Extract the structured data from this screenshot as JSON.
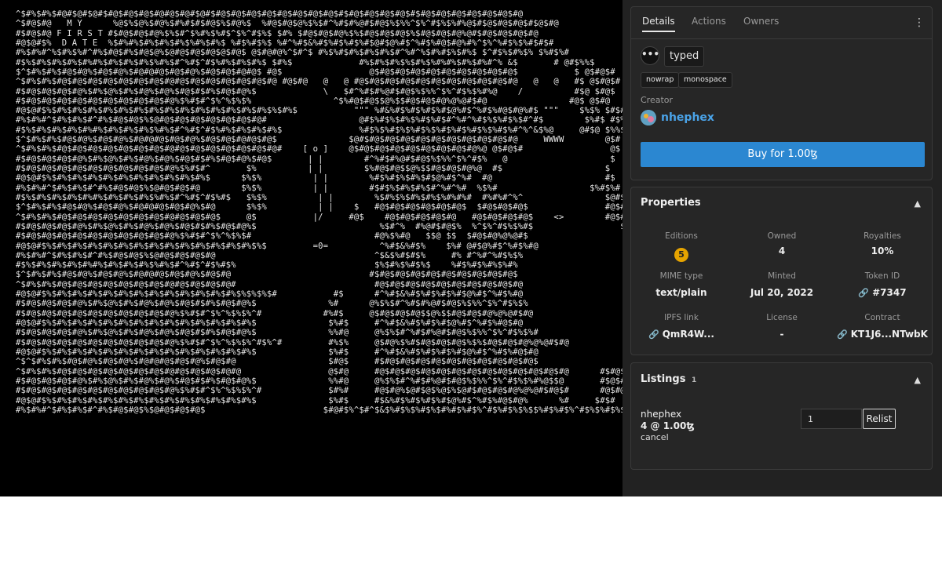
{
  "art": {
    "lines": [
      "^$#%$#%$#@#$@#$@#$#@$#@$#@$#@#@$#@#$@#$#@$#@$#@$#@$#@$#@$#@$#@$#$#@$#@$#@$#@$#$#@$#@$#@$#@$#@$#@$#@",
      "^$#@$#@   M Y      %@$%$@%$#@%$#%#$#$#@$%$#@%$  %#@$#@$@%$%$#^%#$#%@#$#@$%$%%^$%^#$%$%#%@$#$@$#@$#@$#$@$#@",
      "#$#@$#@ F I R S T #$#@$#@$#@%$%$#^$%#%$%#$^$%^#$%$ $#% $#@$#@$#@%$%$#@$#@$#@$%$#@$#@$#@%@#$#@$#@$#@$#@",
      "#@$@#$%  D A T E  %$#%#%$#%$#%$#%$%#%$#%$ %#$%#$%$ %#^%#$&%#$%#$%#$%#$@#$@%#$^%#$%#@$#@%#%^$%^%#$%$%#$#$#",
      "#%$#%#^%$#%$%#^#%$#@$#%$#@$@%$@#@$#@$#@$@$#@$ @$#@#@%^$#^$ #%$%#$#%$#%$#%$#^%#^%$#%#$%$#%$ $^#$%$#%$% $%#$%#",
      "#$%$#%$#%$#%$#%#%$#%$#%$#%$%#%$#^%#$^#$%#%$#%$#%$ $#%$             #%$#%$#%$%$#%$%#%#%$#%$#%#^% &$       # @#$%%$",
      "$^$#%$#%$#@$#@%$#@$#@%$#@#@#@$#@$#@%$#@$#@$#@#@$ #@$                 @$#@$#@$#@$#@$#@$#@$#@$#@$#@$           $ @$#@$#",
      "^$#%$#%$#@$#@$#@$#@$#@$#@$#@$#@#@$#@$#@$#@$#@$#@$#@ #@$#@   @   @ #@$#@$#@$#@$#@$#@$#@$#@$#@$#@$#@   @   @   #$ @$#@$#",
      "#$#@$#@$#@$#@%$#%$@%$#%$#@%$#@%$#@$#$#%$#@$#@%$             \\   $#^%#$#%@#$#@$%$%%^$%^#$%$%#%@    /          #$@ $#@$",
      "#$#@$#@$#@$#@$#@$#@$#@$#@$#@$#@%$%#$#^$%^%$%$%                ^$%#@$#@$$@%$$#@$#@$#@%@%@#$#@                #@$ @$#@",
      "#@$@#$%$#%$#%$#%$#%$#%$#%$#%$#%$#%$#%$#%$#%$#%$#%$%$#%$           \"\"\" %#&%#$%#$%#$%#$@%#$^%#$%#@$#@%#$ \"\"\"    $%$% $#$#",
      "#%$#%#^$#%$#%$#^#%$#@$#@$%$@#@$#@$#@$#@$#@$#@$#@#                  @#$%#$%$#%$%#$%#$#^%#^%#$%$%#$%$#^#$        $%#$ #$%#",
      "#$%$#%$#%$#%$#%#%$#%$#%$#%$%#%$#^%#$^#$%#%$#%$#%$#%$               %#$%$%#$%$%#$%$%#$%#$%#$%$%#$%#^%^&$%@     @#$@ $%%$",
      "$^$#%$#%$#@$#@%$#@$#@%$#@#@#@$#@$#@%$#@$#@$#@#@$#@$              $@#$#@$#@$#@$#@$#@$#@$#@$#@$#@$#@     WWWW        @$#",
      "^$#%$#%$#@$#@$#@$#@$#@$#@$#@$#@#@$#@$#@$#@$#@$#@$#@#    [ o ]    @$#@$#@$#@$#@$#@$#@$#@$#@%@ @$#@$#                 @$",
      "#$#@$#@$#@$#@%$#%$@%$#%$#@%$#@%$#@$#$#%$#@$#@%$#@$       | |        #^%#$#%@#$#@$%$%%^$%^#$%   @                    $",
      "#$#@$#@$#@$#@$#@$#@$#@$#@$#@$#@%$%#$#^       $%          | |        $%#@$#@$$@%$$#@$#@$#@%@  #$                    $",
      "#@$@#$%$#%$#%$#%$#%$#%$#%$#%$#%$#%$#%$      $%$%          | |        %#$%#$%$#%$#$@%#$^%#  #@                      #$",
      "#%$#%#^$#%$#%$#^#%$#@$#@$%$@#@$#@$#@        $%$%          | |        #$#$%$#%$#%$#^%#^%#  %$%#                  $%#$%#",
      "#$%$#%$#%$#%$#%#%$#%$#%$#%$%#%$#^%#$^#$%#$   $%$%          | |        %$#%$%$#%$#%$%#%#%#  #%#%#^%^                $@#$%%$",
      "$^$#%$#%$#@$#@%$#@$#@%$#@#@#@$#@$#@%$#@      $%$%          | |    $   #@$#@$#@$#@$#@$#@$  $#@$#@$#@$               #@$#@$#",
      "^$#%$#%$#@$#@$#@$#@$#@$#@$#@$#@#@$#@$#@$     @$           |/     #@$    #@$#@$#@$#@$#@   #@$#@$#@$#@$    <>        #@$#@$",
      "#$#@$#@$#@$#@%$#%$@%$#%$#@%$#@%$#@$#$#%$#@$#@%$                        %$#^%  #%@#$#@$%  %^$%^#$%$%#$                 $$#@$",
      "#$#@$#@$#@$#@$#@$#@$#@$#@$#@$#@%$%#$#^$%^%$%$#                        #@%$%#@   $$@ $$  $#@$#@%@%@#$                   @$#@",
      "#@$@#$%$#%$#%$#%$#%$#%$#%$#%$#%$#%$#%$#%$#%$#%$%$         =0=          ^%#$&%#$%    $%# @#$@%#$^%#$%#@                    #$#",
      "#%$#%#^$#%$#%$#^#%$#@$#@$%$@#@$#@$#@$#@                               ^$&$%#$#$%     #% #^%#^%#$%$%                       $%#",
      "#$%$#%$#%$#%$#%#%$#%$#%$#%$%#%$#^%#$^#$%#$%                           $%$#%$%#$%$    %#$%#$%#%$%#%                        %%$",
      "$^$#%$#%$#@$#@%$#@$#@%$#@#@#@$#@$#@%$#@$#@                           #$#@$#@$#@$#@$#@$#@$#@$#@$#@$                        @$#",
      "^$#%$#%$#@$#@$#@$#@$#@$#@$#@$#@#@$#@$#@$#@#                           #@$#@$#@$#@$#@$#@$#@$#@$#@$#@                       #@$",
      "#@$@#$%$#%$#%$#%$#%$#%$#%$#%$#%$#%$#%$#%$#%$%$%$%$#           #$      #^%#$&%#$%#$%#$%#$@%#$^%#$%#@                      #@#",
      "#$#@$#@$#@$#@%$#%$@%$#%$#@%$#@%$#@$#$#%$#@$#@%$              %#      @%$%$#^%#$#%@#$#@$%$%%^$%^#$%$%                      $#@$",
      "#$#@$#@$#@$#@$#@$#@$#@$#@$#@$#@%$%#$#^$%^%$%$%^#            #%#$     @$#@$#@$#@$$@%$$#@$#@$#@%@%@#$#@                      @$#@",
      "#@$@#$%$#%$#%$#%$#%$#%$#%$#%$#%$#%$#%$#%$#%$#%$              $%#$     #^%#$&%#$%#$%#$@%#$^%#$%#@$#@                      $#$#",
      "#$#@$#@$#@$#@%$#%$@%$#%$#@%$#@%$#@$#$#%$#@$#@%$              %%#@     @%$%$#^%#$#%@#$#@$%$%%^$%^#$%$%#                     $#@$",
      "#$#@$#@$#@$#@$#@$#@$#@$#@$#@$#@%$%#$#^$%^%$%$%^#$%^#         #%$%     @$#@%$%#$#@$#@$#@$%$%$#@$#@$#@%@%@#$#@                  @$#@",
      "#@$@#$%$#%$#%$#%$#%$#%$#%$#%$#%$#%$#%$#%$#%$#%$              $%#$     #^%#$&%#$%#$%#$%#$@%#$^%#$%#@$#@                   $#$#",
      "^$^$#%$#%$#@$#@%$#@$#@%$#@#@#@$#@$#@%$#@$#@                  $#@$     #$#@$#@$#@$#@$#@$#@$#@$#@$#@$#@$                    #@$#",
      "^$#%$#%$#@$#@$#@$#@$#@$#@$#@$#@#@$#@$#@$#@#@                 @$#@     #@$#@$#@$#@$#@$#@$#@$#@$#@$#@$#@$#@$#@      #$#@$#@$",
      "#$#@$#@$#@$#@%$#%$@%$#%$#@%$#@%$#@$#$#%$#@$#@%$              %%#@     @%$%$#^%#$#%@#$#@$%$%%^$%^#$%$%#%@$$@       #$@$#@$#",
      "#$#@$#@$#@$#@$#@$#@$#@$#@$#@$#@%$%#$#^$%^%$%$%^#             $#%#     #@$#@%$@#$@$%@$%$@#$#@$#@$#@%@%@#$#@$#      #@$#@$#@",
      "#@$@#$%$#%$#%$#%$#%$#%$#%$#%$#%$#%$#%$#%$#%$#%$              $%#$     #$&%#$%#$%#$%#$@%#$^%#$%#@$#@%      %#     $#$#",
      "#%$#%#^$#%$#%$#^#%$#@$#@$%$@#@$#@$#@$                       $#@#$%^$#^$&$%#$%$%#$%$#%#$%#$%^#$%#$%$%$$%#$%#$%^#$%$%#$%$%#$%$#"
    ]
  },
  "tabs": {
    "details": "Details",
    "actions": "Actions",
    "owners": "Owners"
  },
  "details": {
    "menu_glyph": "•••",
    "tag_primary": "typed",
    "tag_nowrap": "nowrap",
    "tag_monospace": "monospace",
    "creator_label": "Creator",
    "creator_name": "nhephex",
    "buy_label": "Buy for 1.00ꜩ"
  },
  "properties": {
    "title": "Properties",
    "editions_label": "Editions",
    "editions_value": "5",
    "owned_label": "Owned",
    "owned_value": "4",
    "royalties_label": "Royalties",
    "royalties_value": "10%",
    "mime_label": "MIME type",
    "mime_value": "text/plain",
    "minted_label": "Minted",
    "minted_value": "Jul 20, 2022",
    "token_label": "Token ID",
    "token_value": "#7347",
    "ipfs_label": "IPFS link",
    "ipfs_value": "QmR4W...",
    "license_label": "License",
    "license_value": "-",
    "contract_label": "Contract",
    "contract_value": "KT1J6...NTwbK"
  },
  "listings": {
    "title": "Listings",
    "count": "1",
    "seller": "nhephex",
    "amount": "4 @ 1.00ꜩ",
    "cancel_label": "cancel",
    "quantity_value": "1",
    "relist_label": "Relist"
  },
  "colors": {
    "accent": "#2b87d1",
    "badge": "#e6a400",
    "panel": "#262626"
  }
}
